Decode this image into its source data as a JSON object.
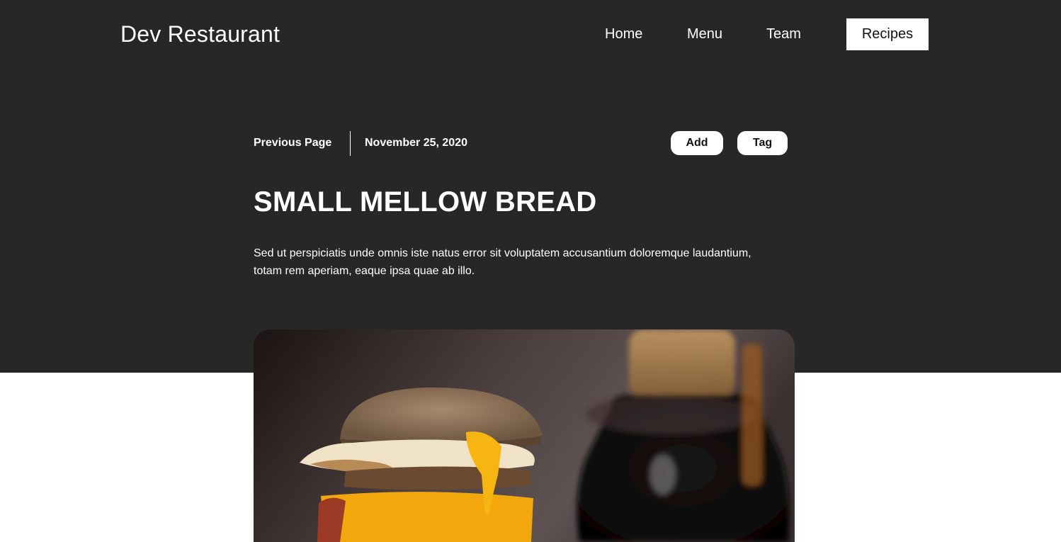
{
  "brand": {
    "name": "Dev Restaurant"
  },
  "nav": {
    "items": [
      {
        "label": "Home"
      },
      {
        "label": "Menu"
      },
      {
        "label": "Team"
      },
      {
        "label": "Recipes",
        "active": true
      }
    ]
  },
  "meta": {
    "previous_label": "Previous Page",
    "date": "November 25, 2020"
  },
  "actions": {
    "add_label": "Add",
    "tag_label": "Tag"
  },
  "article": {
    "title": "SMALL MELLOW BREAD",
    "description": "Sed ut perspiciatis unde omnis iste natus error sit voluptatem accusantium doloremque laudantium, totam rem aperiam, eaque ipsa quae ab illo."
  },
  "colors": {
    "header_bg": "#272727",
    "page_bg": "#ffffff",
    "text_light": "#ffffff",
    "text_dark": "#111111"
  }
}
